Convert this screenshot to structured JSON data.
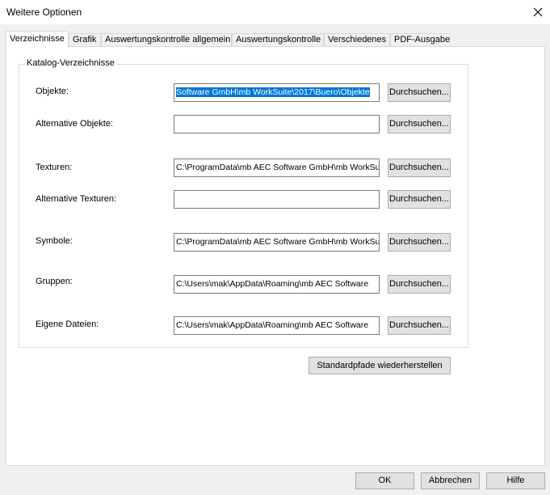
{
  "window": {
    "title": "Weitere Optionen"
  },
  "tabs": [
    {
      "label": "Verzeichnisse",
      "active": true
    },
    {
      "label": "Grafik"
    },
    {
      "label": "Auswertungskontrolle allgemein"
    },
    {
      "label": "Auswertungskontrolle"
    },
    {
      "label": "Verschiedenes"
    },
    {
      "label": "PDF-Ausgabe"
    }
  ],
  "catalog": {
    "legend": "Katalog-Verzeichnisse",
    "rows": [
      {
        "label": "Objekte:",
        "value": "Software GmbH\\mb WorkSuite\\2017\\Buero\\Objekte",
        "browse": "Durchsuchen..."
      },
      {
        "label": "Alternative Objekte:",
        "value": "",
        "browse": "Durchsuchen..."
      },
      {
        "label": "Texturen:",
        "value": "C:\\ProgramData\\mb AEC Software GmbH\\mb WorkSuite",
        "browse": "Durchsuchen..."
      },
      {
        "label": "Alternative Texturen:",
        "value": "",
        "browse": "Durchsuchen..."
      },
      {
        "label": "Symbole:",
        "value": "C:\\ProgramData\\mb AEC Software GmbH\\mb WorkSuite",
        "browse": "Durchsuchen..."
      },
      {
        "label": "Gruppen:",
        "value": "C:\\Users\\mak\\AppData\\Roaming\\mb AEC Software",
        "browse": "Durchsuchen..."
      },
      {
        "label": "Eigene Dateien:",
        "value": "C:\\Users\\mak\\AppData\\Roaming\\mb AEC Software",
        "browse": "Durchsuchen..."
      }
    ]
  },
  "restore_label": "Standardpfade wiederherstellen",
  "footer": {
    "ok": "OK",
    "cancel": "Abbrechen",
    "help": "Hilfe"
  },
  "icons": {
    "close": "close-icon"
  },
  "colors": {
    "selection": "#0078d7",
    "panel": "#ffffff",
    "dialog_bg": "#f0f0f0"
  }
}
